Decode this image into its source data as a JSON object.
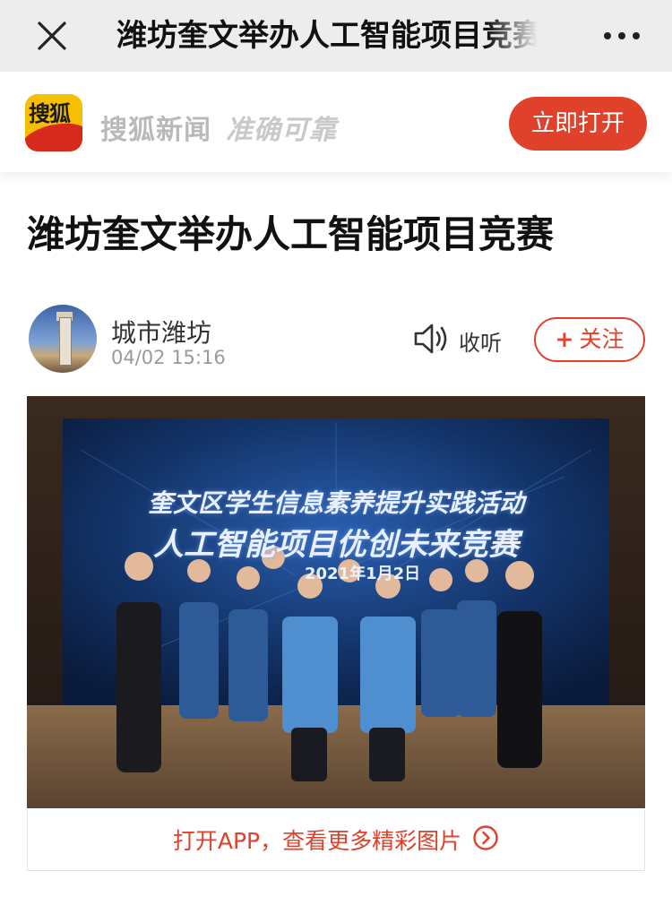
{
  "nav": {
    "title": "潍坊奎文举办人工智能项目竞赛",
    "close_icon": "close-icon",
    "more_icon": "more-icon"
  },
  "banner": {
    "logo_text": "搜狐",
    "slogan": "搜狐新闻",
    "slogan_tagline": "准确可靠",
    "open_button": "立即打开"
  },
  "article": {
    "headline": "潍坊奎文举办人工智能项目竞赛",
    "author": {
      "name": "城市潍坊",
      "time": "04/02 15:16"
    },
    "listen_label": "收听",
    "follow_label": "关注",
    "follow_prefix": "+"
  },
  "photo": {
    "banner_line1": "奎文区学生信息素养提升实践活动",
    "banner_line2": "人工智能项目优创未来竞赛",
    "banner_date": "2021年1月2日"
  },
  "open_app": {
    "label": "打开APP，查看更多精彩图片"
  },
  "colors": {
    "accent": "#e0412a",
    "nav_bg": "#ededed"
  }
}
